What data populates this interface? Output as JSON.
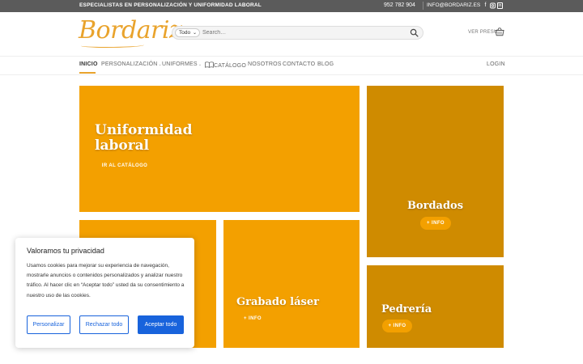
{
  "topbar": {
    "tagline": "ESPECIALISTAS EN PERSONALIZACIÓN Y UNIFORMIDAD LABORAL",
    "phone": "952 782 904",
    "email": "INFO@BORDARIZ.ES",
    "social_icons": [
      "facebook-icon",
      "instagram-icon",
      "linkedin-icon"
    ]
  },
  "header": {
    "logo_text": "Bordariz",
    "search": {
      "category": "Todo",
      "placeholder": "Search…"
    },
    "cart_label": "VER PRESU"
  },
  "nav": {
    "items": [
      {
        "label": "INICIO",
        "active": true
      },
      {
        "label": "PERSONALIZACIÓN",
        "dropdown": true
      },
      {
        "label": "UNIFORMES",
        "dropdown": true
      },
      {
        "label": "CATÁLOGO",
        "icon": "book-icon"
      },
      {
        "label": "NOSOTROS"
      },
      {
        "label": "CONTACTO"
      },
      {
        "label": "BLOG"
      }
    ],
    "login": "LOGIN"
  },
  "tiles": {
    "uniformidad": {
      "title": "Uniformidad laboral",
      "button": "IR AL CATÁLOGO"
    },
    "bordados": {
      "title": "Bordados",
      "button": "+ INFO"
    },
    "grabado": {
      "title": "Grabado láser",
      "button": "+ INFO"
    },
    "pedreria": {
      "title": "Pedrería",
      "button": "+ INFO"
    }
  },
  "cookie": {
    "title": "Valoramos tu privacidad",
    "text": "Usamos cookies para mejorar su experiencia de navegación, mostrarle anuncios o contenidos personalizados y analizar nuestro tráfico. Al hacer clic en “Aceptar todo” usted da su consentimiento a nuestro uso de las cookies.",
    "buttons": {
      "customize": "Personalizar",
      "reject": "Rechazar todo",
      "accept": "Aceptar todo"
    }
  },
  "colors": {
    "accent": "#e9a32c",
    "tile_orange": "#f3a000",
    "tile_dark": "#cf8b00",
    "topbar": "#5b5b5b",
    "cookie_blue": "#1863dc"
  }
}
